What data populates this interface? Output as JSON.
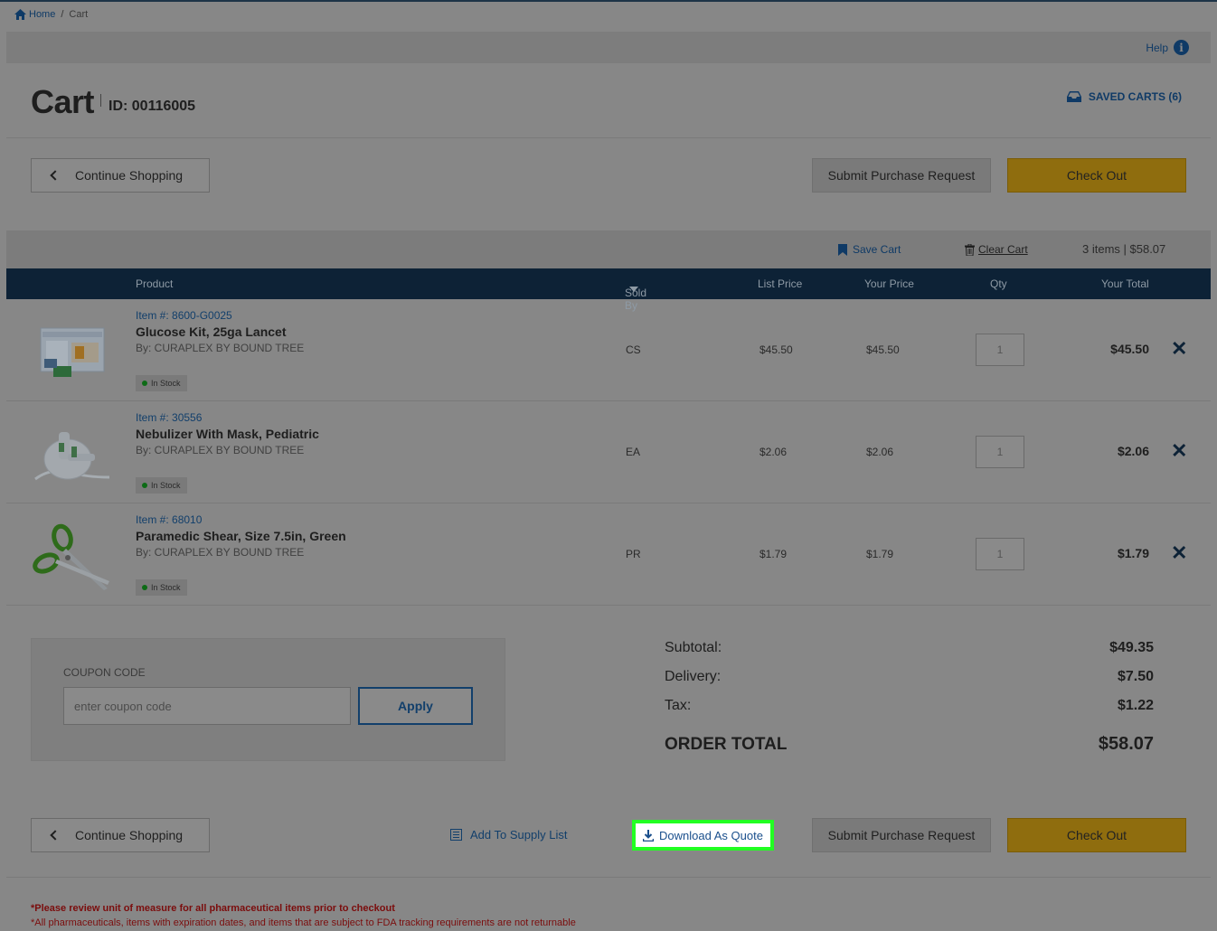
{
  "breadcrumb": {
    "home": "Home",
    "separator": "/",
    "current": "Cart"
  },
  "help": {
    "label": "Help",
    "icon": "info-icon"
  },
  "header": {
    "title": "Cart",
    "id_label": "ID: 00116005",
    "saved_carts": "SAVED CARTS (6)"
  },
  "buttons": {
    "continue_shopping": "Continue Shopping",
    "submit_purchase_request": "Submit Purchase Request",
    "check_out": "Check Out",
    "apply": "Apply",
    "add_to_supply_list": "Add To Supply List",
    "download_as_quote": "Download As Quote"
  },
  "toolbar": {
    "save_cart": "Save Cart",
    "clear_cart": "Clear Cart",
    "summary": "3 items | $58.07"
  },
  "table": {
    "headers": {
      "product": "Product",
      "sold_by": "Sold By",
      "list_price": "List Price",
      "your_price": "Your Price",
      "qty": "Qty",
      "your_total": "Your Total"
    },
    "rows": [
      {
        "item_no": "Item #: 8600-G0025",
        "name": "Glucose Kit, 25ga Lancet",
        "brand": "By: CURAPLEX BY BOUND TREE",
        "stock": "In Stock",
        "sold_by": "CS",
        "list_price": "$45.50",
        "your_price": "$45.50",
        "qty": "1",
        "total": "$45.50"
      },
      {
        "item_no": "Item #: 30556",
        "name": "Nebulizer With Mask, Pediatric",
        "brand": "By: CURAPLEX BY BOUND TREE",
        "stock": "In Stock",
        "sold_by": "EA",
        "list_price": "$2.06",
        "your_price": "$2.06",
        "qty": "1",
        "total": "$2.06"
      },
      {
        "item_no": "Item #: 68010",
        "name": "Paramedic Shear, Size 7.5in, Green",
        "brand": "By: CURAPLEX BY BOUND TREE",
        "stock": "In Stock",
        "sold_by": "PR",
        "list_price": "$1.79",
        "your_price": "$1.79",
        "qty": "1",
        "total": "$1.79"
      }
    ]
  },
  "coupon": {
    "label": "COUPON CODE",
    "placeholder": "enter coupon code"
  },
  "summary": {
    "subtotal_label": "Subtotal:",
    "subtotal": "$49.35",
    "delivery_label": "Delivery:",
    "delivery": "$7.50",
    "tax_label": "Tax:",
    "tax": "$1.22",
    "order_total_label": "ORDER TOTAL",
    "order_total": "$58.07"
  },
  "notes": {
    "line1": "*Please review unit of measure for all pharmaceutical items prior to checkout",
    "line2": "*All pharmaceuticals, items with expiration dates, and items that are subject to FDA tracking requirements are not returnable"
  },
  "colors": {
    "navy": "#0d2236",
    "link": "#123f6b",
    "checkout": "#8f6d0e",
    "highlight": "#22ff22",
    "note": "#7b0d0d"
  }
}
